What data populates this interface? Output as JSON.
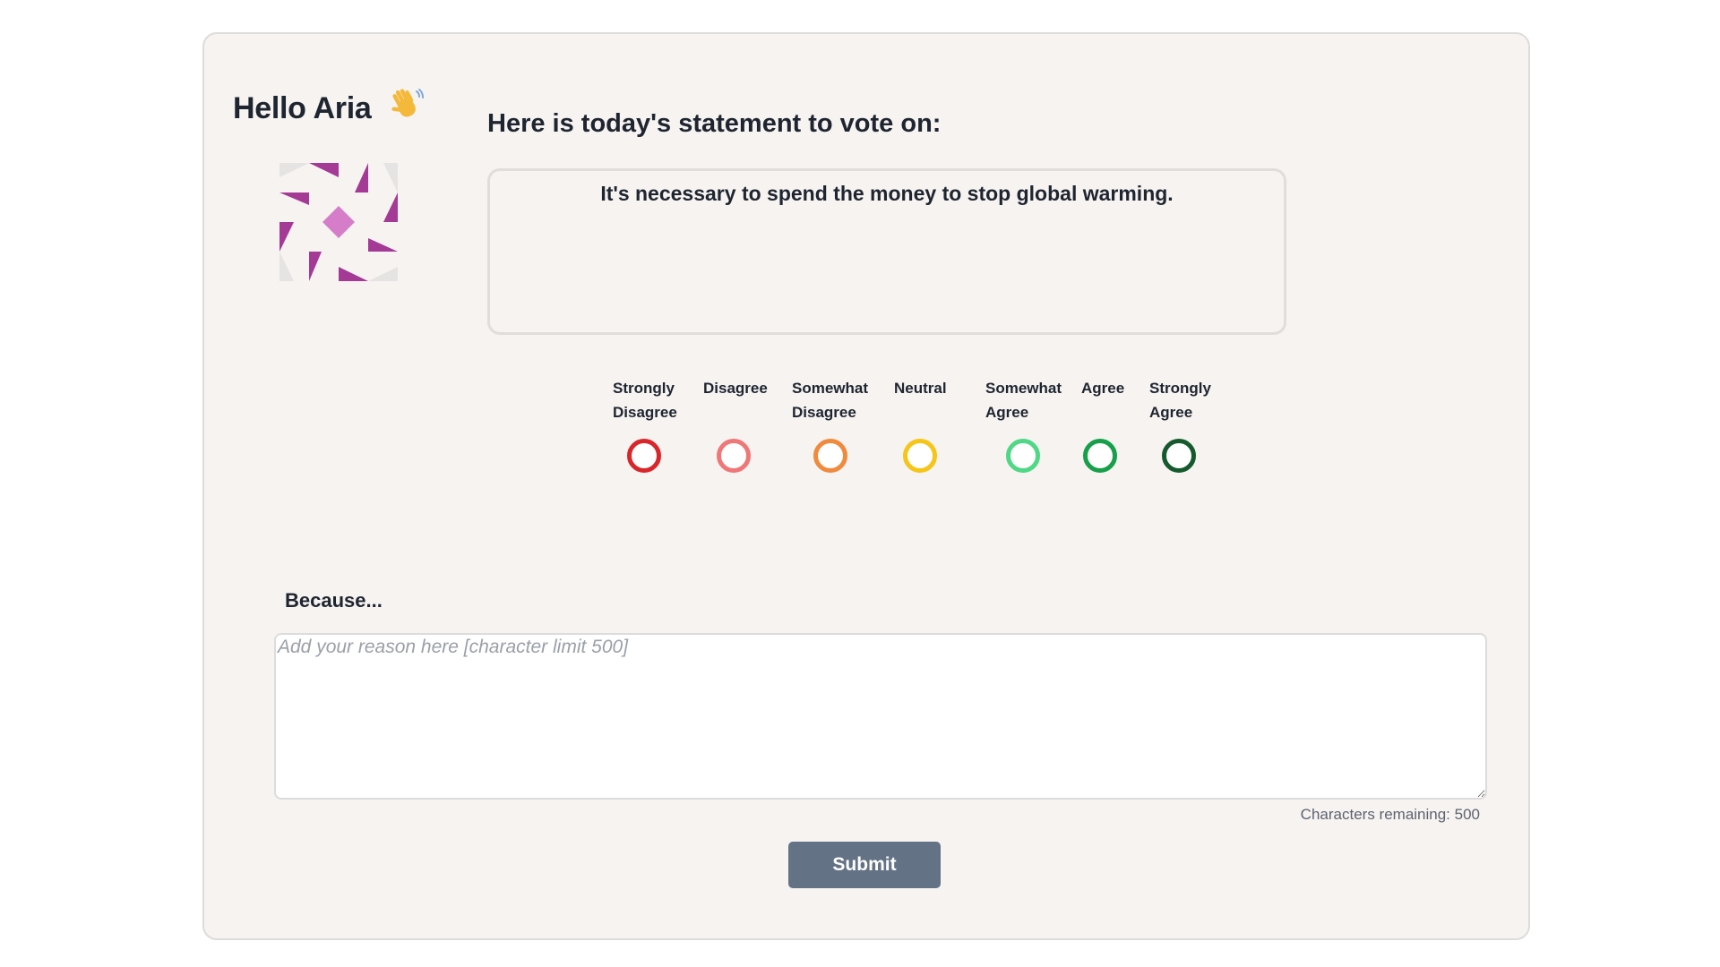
{
  "header": {
    "greeting": "Hello Aria",
    "wave_icon": "waving-hand-icon"
  },
  "avatar": {
    "icon": "identicon-avatar",
    "colors": {
      "primary": "#a43a96",
      "center": "#d57dc8",
      "muted": "#e6e4e3"
    }
  },
  "main": {
    "prompt_title": "Here is today's statement to vote on:",
    "statement": "It's necessary to spend the money to stop global warming."
  },
  "scale": {
    "options": [
      {
        "label": "Strongly\nDisagree",
        "color": "#d8262b"
      },
      {
        "label": "Disagree",
        "color": "#f07777"
      },
      {
        "label": "Somewhat\nDisagree",
        "color": "#f08a3c"
      },
      {
        "label": "Neutral",
        "color": "#f5c518"
      },
      {
        "label": "Somewhat\nAgree",
        "color": "#4fd885"
      },
      {
        "label": "Agree",
        "color": "#16a04a"
      },
      {
        "label": "Strongly\nAgree",
        "color": "#155a2c"
      }
    ]
  },
  "reason": {
    "label": "Because...",
    "placeholder": "Add your reason here [character limit 500]",
    "value": "",
    "counter": "Characters remaining: 500"
  },
  "actions": {
    "submit_label": "Submit",
    "submit_color": "#647286"
  }
}
